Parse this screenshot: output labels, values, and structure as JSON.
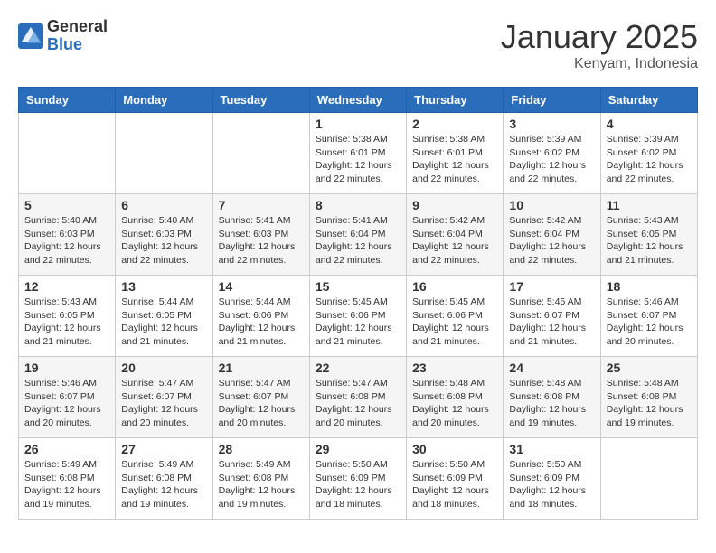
{
  "logo": {
    "general": "General",
    "blue": "Blue"
  },
  "title": "January 2025",
  "location": "Kenyam, Indonesia",
  "days_of_week": [
    "Sunday",
    "Monday",
    "Tuesday",
    "Wednesday",
    "Thursday",
    "Friday",
    "Saturday"
  ],
  "weeks": [
    [
      {
        "day": "",
        "info": ""
      },
      {
        "day": "",
        "info": ""
      },
      {
        "day": "",
        "info": ""
      },
      {
        "day": "1",
        "info": "Sunrise: 5:38 AM\nSunset: 6:01 PM\nDaylight: 12 hours\nand 22 minutes."
      },
      {
        "day": "2",
        "info": "Sunrise: 5:38 AM\nSunset: 6:01 PM\nDaylight: 12 hours\nand 22 minutes."
      },
      {
        "day": "3",
        "info": "Sunrise: 5:39 AM\nSunset: 6:02 PM\nDaylight: 12 hours\nand 22 minutes."
      },
      {
        "day": "4",
        "info": "Sunrise: 5:39 AM\nSunset: 6:02 PM\nDaylight: 12 hours\nand 22 minutes."
      }
    ],
    [
      {
        "day": "5",
        "info": "Sunrise: 5:40 AM\nSunset: 6:03 PM\nDaylight: 12 hours\nand 22 minutes."
      },
      {
        "day": "6",
        "info": "Sunrise: 5:40 AM\nSunset: 6:03 PM\nDaylight: 12 hours\nand 22 minutes."
      },
      {
        "day": "7",
        "info": "Sunrise: 5:41 AM\nSunset: 6:03 PM\nDaylight: 12 hours\nand 22 minutes."
      },
      {
        "day": "8",
        "info": "Sunrise: 5:41 AM\nSunset: 6:04 PM\nDaylight: 12 hours\nand 22 minutes."
      },
      {
        "day": "9",
        "info": "Sunrise: 5:42 AM\nSunset: 6:04 PM\nDaylight: 12 hours\nand 22 minutes."
      },
      {
        "day": "10",
        "info": "Sunrise: 5:42 AM\nSunset: 6:04 PM\nDaylight: 12 hours\nand 22 minutes."
      },
      {
        "day": "11",
        "info": "Sunrise: 5:43 AM\nSunset: 6:05 PM\nDaylight: 12 hours\nand 21 minutes."
      }
    ],
    [
      {
        "day": "12",
        "info": "Sunrise: 5:43 AM\nSunset: 6:05 PM\nDaylight: 12 hours\nand 21 minutes."
      },
      {
        "day": "13",
        "info": "Sunrise: 5:44 AM\nSunset: 6:05 PM\nDaylight: 12 hours\nand 21 minutes."
      },
      {
        "day": "14",
        "info": "Sunrise: 5:44 AM\nSunset: 6:06 PM\nDaylight: 12 hours\nand 21 minutes."
      },
      {
        "day": "15",
        "info": "Sunrise: 5:45 AM\nSunset: 6:06 PM\nDaylight: 12 hours\nand 21 minutes."
      },
      {
        "day": "16",
        "info": "Sunrise: 5:45 AM\nSunset: 6:06 PM\nDaylight: 12 hours\nand 21 minutes."
      },
      {
        "day": "17",
        "info": "Sunrise: 5:45 AM\nSunset: 6:07 PM\nDaylight: 12 hours\nand 21 minutes."
      },
      {
        "day": "18",
        "info": "Sunrise: 5:46 AM\nSunset: 6:07 PM\nDaylight: 12 hours\nand 20 minutes."
      }
    ],
    [
      {
        "day": "19",
        "info": "Sunrise: 5:46 AM\nSunset: 6:07 PM\nDaylight: 12 hours\nand 20 minutes."
      },
      {
        "day": "20",
        "info": "Sunrise: 5:47 AM\nSunset: 6:07 PM\nDaylight: 12 hours\nand 20 minutes."
      },
      {
        "day": "21",
        "info": "Sunrise: 5:47 AM\nSunset: 6:07 PM\nDaylight: 12 hours\nand 20 minutes."
      },
      {
        "day": "22",
        "info": "Sunrise: 5:47 AM\nSunset: 6:08 PM\nDaylight: 12 hours\nand 20 minutes."
      },
      {
        "day": "23",
        "info": "Sunrise: 5:48 AM\nSunset: 6:08 PM\nDaylight: 12 hours\nand 20 minutes."
      },
      {
        "day": "24",
        "info": "Sunrise: 5:48 AM\nSunset: 6:08 PM\nDaylight: 12 hours\nand 19 minutes."
      },
      {
        "day": "25",
        "info": "Sunrise: 5:48 AM\nSunset: 6:08 PM\nDaylight: 12 hours\nand 19 minutes."
      }
    ],
    [
      {
        "day": "26",
        "info": "Sunrise: 5:49 AM\nSunset: 6:08 PM\nDaylight: 12 hours\nand 19 minutes."
      },
      {
        "day": "27",
        "info": "Sunrise: 5:49 AM\nSunset: 6:08 PM\nDaylight: 12 hours\nand 19 minutes."
      },
      {
        "day": "28",
        "info": "Sunrise: 5:49 AM\nSunset: 6:08 PM\nDaylight: 12 hours\nand 19 minutes."
      },
      {
        "day": "29",
        "info": "Sunrise: 5:50 AM\nSunset: 6:09 PM\nDaylight: 12 hours\nand 18 minutes."
      },
      {
        "day": "30",
        "info": "Sunrise: 5:50 AM\nSunset: 6:09 PM\nDaylight: 12 hours\nand 18 minutes."
      },
      {
        "day": "31",
        "info": "Sunrise: 5:50 AM\nSunset: 6:09 PM\nDaylight: 12 hours\nand 18 minutes."
      },
      {
        "day": "",
        "info": ""
      }
    ]
  ]
}
